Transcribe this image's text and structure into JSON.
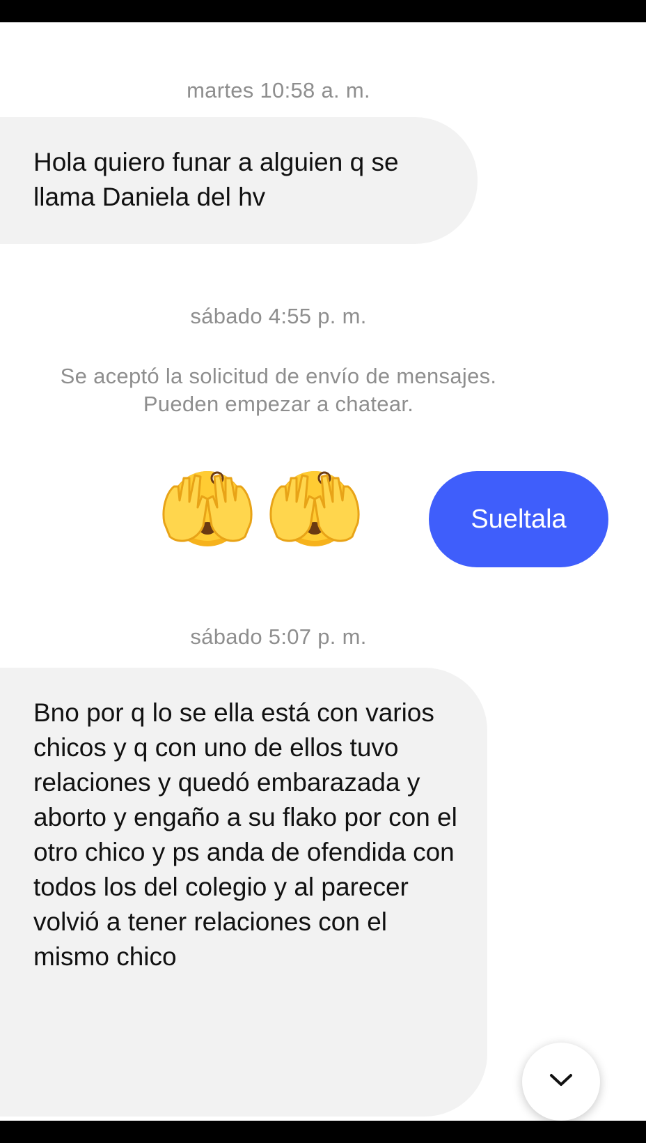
{
  "messages": {
    "ts1": "martes 10:58 a. m.",
    "msg1": "Hola quiero funar a alguien q se llama Daniela del hv",
    "ts2": "sábado 4:55 p. m.",
    "system": "Se aceptó la solicitud de envío de mensajes. Pueden empezar a chatear.",
    "emoji_name": "see-no-evil-face",
    "out1": "Sueltala",
    "ts3": "sábado 5:07 p. m.",
    "msg2": "Bno por q lo se ella está con varios chicos y q con uno de ellos tuvo relaciones y quedó embarazada y aborto y engaño a su flako por con el otro chico y ps anda de ofendida con todos los del colegio y al parecer volvió a tener relaciones con el mismo chico"
  },
  "colors": {
    "outgoing_bubble": "#3f5efb",
    "incoming_bubble": "#f2f2f2",
    "timestamp_text": "#8e8e8e"
  },
  "controls": {
    "scroll_down_icon": "chevron-down-icon"
  }
}
